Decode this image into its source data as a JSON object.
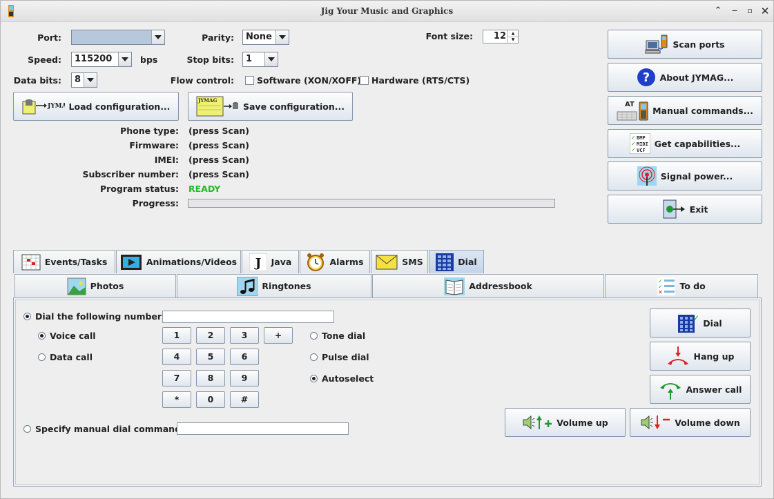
{
  "window": {
    "title": "Jig Your Music and Graphics"
  },
  "settings": {
    "port_label": "Port:",
    "port_value": "",
    "speed_label": "Speed:",
    "speed_value": "115200",
    "speed_unit": "bps",
    "databits_label": "Data bits:",
    "databits_value": "8",
    "parity_label": "Parity:",
    "parity_value": "None",
    "stopbits_label": "Stop bits:",
    "stopbits_value": "1",
    "flow_label": "Flow control:",
    "flow_software": "Software (XON/XOFF)",
    "flow_hardware": "Hardware (RTS/CTS)",
    "fontsize_label": "Font size:",
    "fontsize_value": "12"
  },
  "config": {
    "load_label": "Load configuration...",
    "save_label": "Save configuration...",
    "logo_text": "JYMAG"
  },
  "info": [
    {
      "label": "Phone type:",
      "value": "(press Scan)"
    },
    {
      "label": "Firmware:",
      "value": "(press Scan)"
    },
    {
      "label": "IMEI:",
      "value": "(press Scan)"
    },
    {
      "label": "Subscriber number:",
      "value": "(press Scan)"
    },
    {
      "label": "Program status:",
      "value": "READY"
    },
    {
      "label": "Progress:",
      "value": ""
    }
  ],
  "progress": {
    "fraction": 0
  },
  "colors": {
    "status_ready": "#22bb22",
    "accent_tab": "#c4d5ea"
  },
  "side_buttons": [
    {
      "label": "Scan ports",
      "icon": "scan-ports-icon"
    },
    {
      "label": "About JYMAG...",
      "icon": "help-icon"
    },
    {
      "label": "Manual commands...",
      "icon": "at-commands-icon"
    },
    {
      "label": "Get capabilities...",
      "icon": "capabilities-icon"
    },
    {
      "label": "Signal power...",
      "icon": "signal-icon"
    },
    {
      "label": "Exit",
      "icon": "exit-icon"
    }
  ],
  "capability_badges": [
    "BMP",
    "MIDI",
    "VCF"
  ],
  "at_badge": "AT",
  "tabs_row1": [
    "Events/Tasks",
    "Animations/Videos",
    "Java",
    "Alarms",
    "SMS",
    "Dial"
  ],
  "tabs_row2": [
    "Photos",
    "Ringtones",
    "Addressbook",
    "To do"
  ],
  "java_glyph": "J",
  "dial": {
    "dial_number_label": "Dial the following number",
    "dial_number_value": "",
    "voice_call": "Voice call",
    "data_call": "Data call",
    "keys": [
      "1",
      "2",
      "3",
      "+",
      "4",
      "5",
      "6",
      "7",
      "8",
      "9",
      "*",
      "0",
      "#"
    ],
    "tone_dial": "Tone dial",
    "pulse_dial": "Pulse dial",
    "autoselect": "Autoselect",
    "manual_label": "Specify manual dial command",
    "manual_value": "",
    "btn_dial": "Dial",
    "btn_hangup": "Hang up",
    "btn_answer": "Answer call",
    "btn_volup": "Volume up",
    "btn_voldown": "Volume down"
  }
}
